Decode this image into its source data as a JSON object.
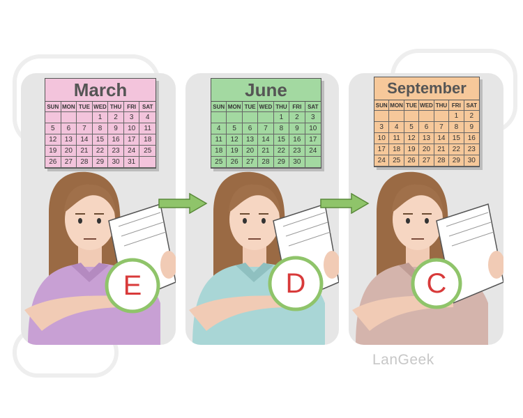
{
  "calendar_headers": [
    "SUN",
    "MON",
    "TUE",
    "WED",
    "THU",
    "FRI",
    "SAT"
  ],
  "calendars": [
    {
      "month": "March",
      "color": "#f3c4dc",
      "days": [
        "",
        "",
        "",
        "1",
        "2",
        "3",
        "4",
        "5",
        "6",
        "7",
        "8",
        "9",
        "10",
        "11",
        "12",
        "13",
        "14",
        "15",
        "16",
        "17",
        "18",
        "19",
        "20",
        "21",
        "22",
        "23",
        "24",
        "25",
        "26",
        "27",
        "28",
        "29",
        "30",
        "31",
        ""
      ]
    },
    {
      "month": "June",
      "color": "#a3d9a1",
      "days": [
        "",
        "",
        "",
        "",
        "1",
        "2",
        "3",
        "4",
        "5",
        "6",
        "7",
        "8",
        "9",
        "10",
        "11",
        "12",
        "13",
        "14",
        "15",
        "16",
        "17",
        "18",
        "19",
        "20",
        "21",
        "22",
        "23",
        "24",
        "25",
        "26",
        "27",
        "28",
        "29",
        "30",
        ""
      ]
    },
    {
      "month": "September",
      "color": "#f6c89a",
      "days": [
        "",
        "",
        "",
        "",
        "",
        "1",
        "2",
        "3",
        "4",
        "5",
        "6",
        "7",
        "8",
        "9",
        "10",
        "11",
        "12",
        "13",
        "14",
        "15",
        "16",
        "17",
        "18",
        "19",
        "20",
        "21",
        "22",
        "23",
        "24",
        "25",
        "26",
        "27",
        "28",
        "29",
        "30"
      ]
    }
  ],
  "grades": [
    "E",
    "D",
    "C"
  ],
  "shirt_colors": [
    "#c8a0d4",
    "#a9d6d6",
    "#d4b4ac"
  ],
  "accent_green": "#8fc46a",
  "watermark": "LanGeek"
}
